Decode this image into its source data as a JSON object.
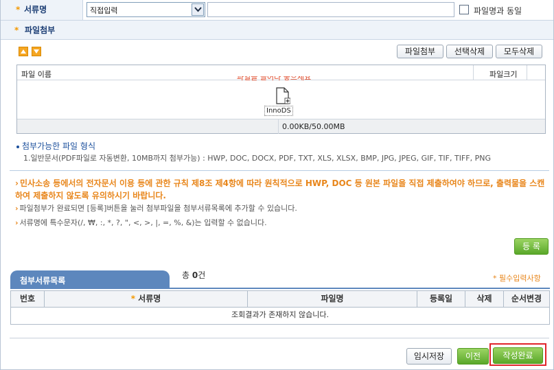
{
  "doc_name": {
    "label": "서류명",
    "select_value": "직접입력",
    "input_value": "",
    "same_as_file_label": "파일명과 동일"
  },
  "attach": {
    "label": "파일첨부",
    "buttons": {
      "attach": "파일첨부",
      "delete_selected": "선택삭제",
      "delete_all": "모두삭제"
    }
  },
  "upload": {
    "col_name": "파일 이름",
    "col_size": "파일크기",
    "drop_hint": "파일을 끌어다 놓으세요",
    "brand": "InnoDS",
    "size_status": "0.00KB/50.00MB"
  },
  "formats": {
    "title": "첨부가능한 파일 형식",
    "text": "1.일반문서(PDF파일로 자동변환, 10MB까지 첨부가능) : HWP, DOC, DOCX, PDF, TXT, XLS, XLSX, BMP, JPG, JPEG, GIF, TIF, TIFF, PNG"
  },
  "notices": {
    "main": "민사소송 등에서의 전자문서 이용 등에 관한 규칙 제8조 제4항에 따라 원칙적으로 HWP, DOC 등 원본 파일을 직접 제출하여야 하므로, 출력물을 스캔하여 제출하지 않도록 유의하시기 바랍니다.",
    "n1": "파일첨부가 완료되면 [등록]버튼을 눌러 첨부파일을 첨부서류목록에 추가할 수 있습니다.",
    "n2": "서류명에 특수문자(/, ₩, :, *, ?, \", <, >, |, =, %, &)는 입력할 수 없습니다."
  },
  "register_button": "등 록",
  "list": {
    "tab_title": "첨부서류목록",
    "total_prefix": "총 ",
    "total_count": "0",
    "total_suffix": "건",
    "required_note": "* 필수입력사항",
    "columns": [
      "번호",
      "서류명",
      "파일명",
      "등록일",
      "삭제",
      "순서변경"
    ],
    "empty_message": "조회결과가 존재하지 않습니다."
  },
  "footer": {
    "temp_save": "임시저장",
    "prev": "이전",
    "complete": "작성완료"
  },
  "colors": {
    "accent_orange": "#e8861b",
    "tab_blue": "#5d87bd",
    "green": "#5aa82a",
    "highlight": "#e0242a"
  }
}
